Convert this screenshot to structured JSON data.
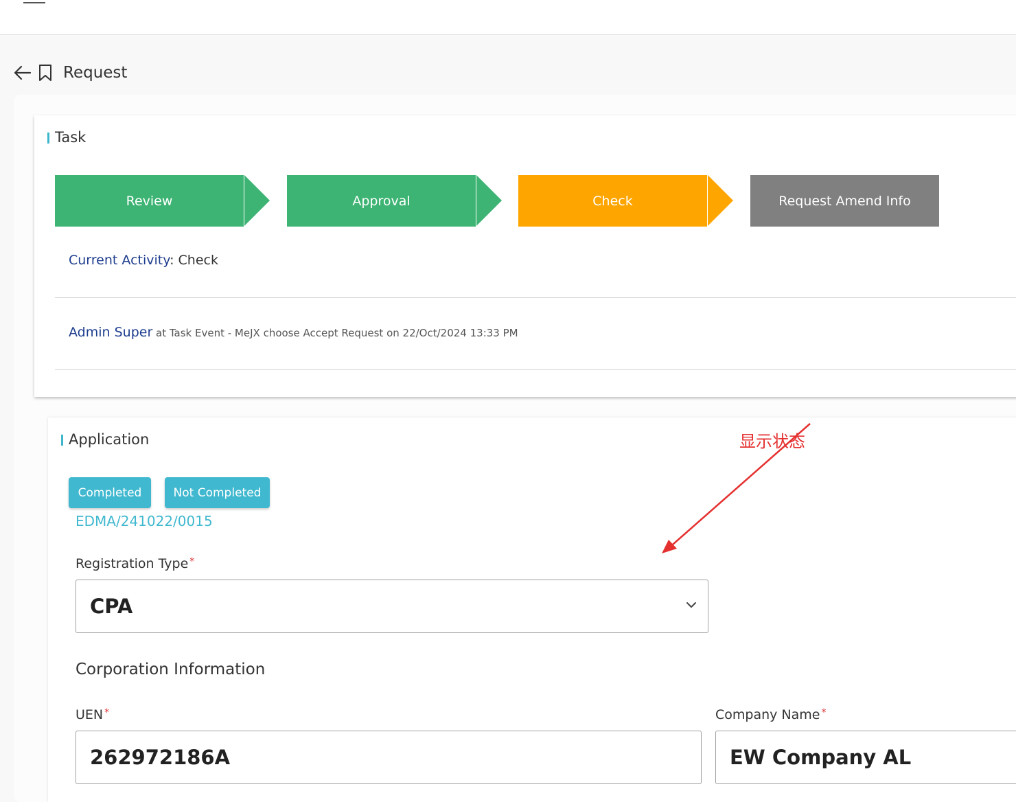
{
  "header": {
    "title": "Request"
  },
  "task": {
    "section_title": "Task",
    "steps": [
      {
        "label": "Review",
        "color": "#3db473"
      },
      {
        "label": "Approval",
        "color": "#3db473"
      },
      {
        "label": "Check",
        "color": "#ffa500"
      },
      {
        "label": "Request Amend Info",
        "color": "#808080"
      }
    ],
    "current_activity_label": "Current Activity",
    "current_activity_value": ": Check",
    "event_user": "Admin Super",
    "event_text": " at Task Event - MeJX choose Accept Request on 22/Oct/2024 13:33 PM"
  },
  "application": {
    "section_title": "Application",
    "status_buttons": [
      "Completed",
      "Not Completed"
    ],
    "reference_no": "EDMA/241022/0015",
    "registration_type_label": "Registration Type",
    "registration_type_value": "CPA",
    "corporation_heading": "Corporation Information",
    "uen_label": "UEN",
    "uen_value": "262972186A",
    "company_name_label": "Company Name",
    "company_name_value": "EW Company AL",
    "required_mark": "*"
  },
  "annotation": {
    "text": "显示状态",
    "color": "#e53030"
  },
  "colors": {
    "accent": "#40b8cf",
    "link": "#1e3d8f",
    "required": "#d33333"
  }
}
